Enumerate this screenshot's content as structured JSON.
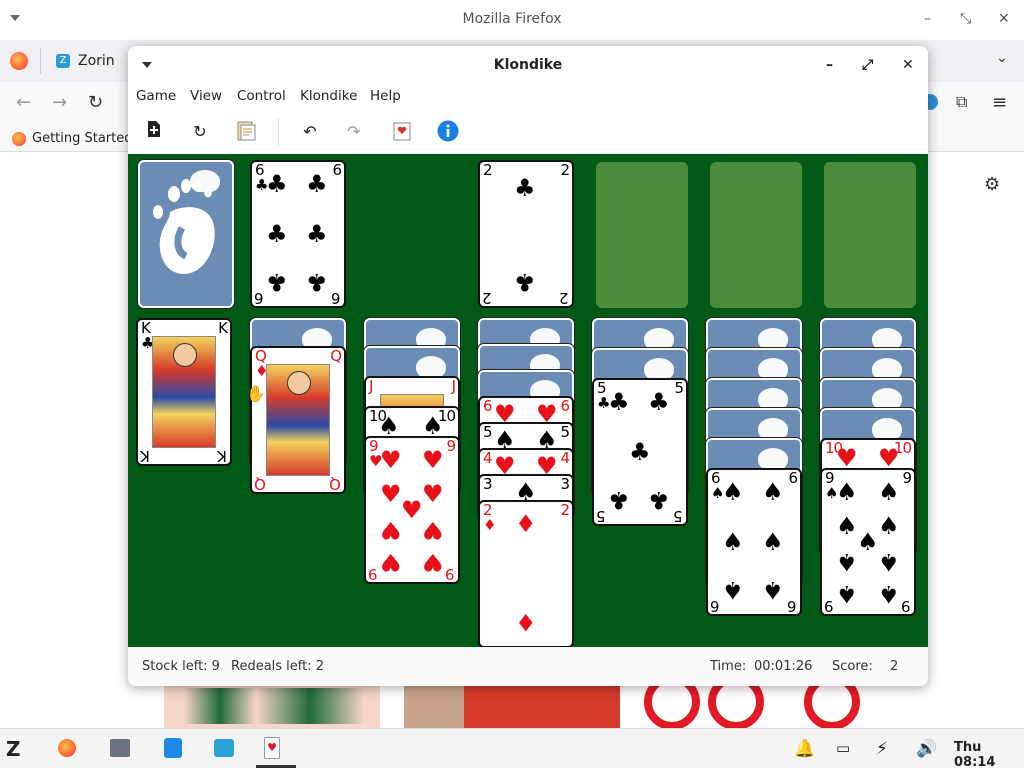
{
  "firefox": {
    "title": "Mozilla Firefox",
    "tab_label": "Zorin OS",
    "bookmark": "Getting Started"
  },
  "klondike": {
    "title": "Klondike",
    "menu": [
      "Game",
      "View",
      "Control",
      "Klondike",
      "Help"
    ],
    "status": {
      "stock": "Stock left: 9",
      "redeals": "Redeals left: 2",
      "time_label": "Time:",
      "time_value": "00:01:26",
      "score_label": "Score:",
      "score_value": "2"
    },
    "stock_card": "back",
    "waste": [
      {
        "rank": "6",
        "suit": "clubs"
      }
    ],
    "foundations": [
      {
        "rank": "2",
        "suit": "clubs"
      },
      null,
      null,
      null
    ],
    "tableau": [
      {
        "face_down": 0,
        "face_up": [
          {
            "rank": "K",
            "suit": "clubs"
          }
        ]
      },
      {
        "face_down": 1,
        "face_up": [
          {
            "rank": "Q",
            "suit": "diamonds"
          }
        ]
      },
      {
        "face_down": 2,
        "face_up": [
          {
            "rank": "J",
            "suit": "diamonds"
          },
          {
            "rank": "10",
            "suit": "spades"
          },
          {
            "rank": "9",
            "suit": "hearts"
          }
        ]
      },
      {
        "face_down": 3,
        "face_up": [
          {
            "rank": "6",
            "suit": "hearts"
          },
          {
            "rank": "5",
            "suit": "spades"
          },
          {
            "rank": "4",
            "suit": "hearts"
          },
          {
            "rank": "3",
            "suit": "spades"
          },
          {
            "rank": "2",
            "suit": "diamonds"
          }
        ]
      },
      {
        "face_down": 2,
        "face_up": [
          {
            "rank": "5",
            "suit": "clubs"
          }
        ]
      },
      {
        "face_down": 5,
        "face_up": [
          {
            "rank": "6",
            "suit": "spades"
          }
        ]
      },
      {
        "face_down": 4,
        "face_up": [
          {
            "rank": "10",
            "suit": "hearts"
          },
          {
            "rank": "9",
            "suit": "spades"
          }
        ]
      }
    ]
  },
  "taskbar": {
    "clock": "Thu 08:14"
  },
  "colors": {
    "felt": "#005a15",
    "slot": "#4c8a3c",
    "card_back": "#6b8cb4",
    "red_suit": "#e8111a"
  }
}
